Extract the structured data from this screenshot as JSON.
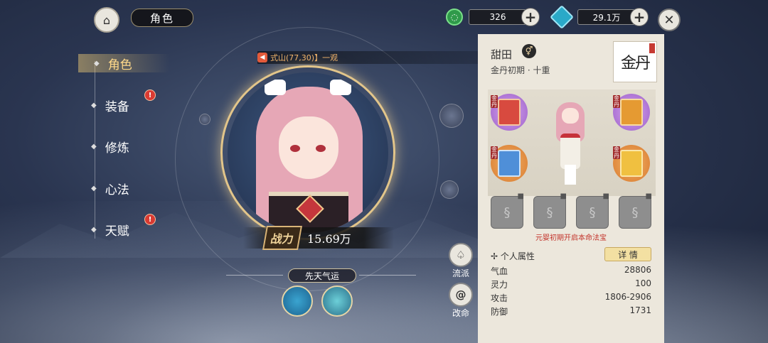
{
  "header": {
    "title": "角色",
    "home_icon": "pavilion-icon"
  },
  "resources": [
    {
      "icon": "jade-ring-icon",
      "value": "326"
    },
    {
      "icon": "spirit-crystal-icon",
      "value": "29.1万"
    }
  ],
  "nav": {
    "items": [
      {
        "label": "角色",
        "active": true,
        "badge": ""
      },
      {
        "label": "装备",
        "active": false,
        "badge": "!"
      },
      {
        "label": "修炼",
        "active": false,
        "badge": ""
      },
      {
        "label": "心法",
        "active": false,
        "badge": ""
      },
      {
        "label": "天赋",
        "active": false,
        "badge": "!"
      }
    ]
  },
  "notice": {
    "text": "式山(77,30)】一观"
  },
  "power": {
    "label": "战力",
    "value": "15.69万"
  },
  "fortune": {
    "label": "先天气运"
  },
  "side_buttons": [
    {
      "icon": "flow-school-icon",
      "label": "流派"
    },
    {
      "icon": "fate-swirl-icon",
      "label": "改命"
    }
  ],
  "character": {
    "name": "甜田",
    "gender_icon": "gender-symbol-icon",
    "realm": "金丹初期 · 十重",
    "seal_text": "金丹",
    "treasure_tag": "金丹",
    "slot_hint": "元婴初期开启本命法宝"
  },
  "attributes": {
    "header": "个人属性",
    "detail_label": "详 情",
    "rows": [
      {
        "name": "气血",
        "value": "28806"
      },
      {
        "name": "灵力",
        "value": "100"
      },
      {
        "name": "攻击",
        "value": "1806-2906"
      },
      {
        "name": "防御",
        "value": "1731"
      }
    ]
  },
  "colors": {
    "accent_gold": "#e2c58a",
    "badge_red": "#d93a32",
    "panel_bg": "#ece7dc",
    "hint_red": "#c3342c"
  }
}
